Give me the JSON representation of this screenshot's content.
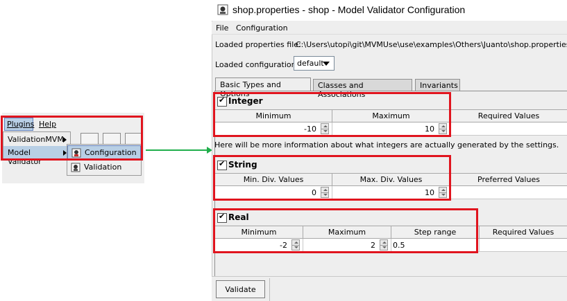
{
  "left_menu": {
    "menubar": {
      "plugins": "Plugins",
      "help": "Help"
    },
    "dropdown": [
      {
        "label": "ValidationMVM"
      },
      {
        "label": "Model Validator"
      }
    ],
    "submenu": [
      {
        "label": "Configuration",
        "icon": "model-validator-icon"
      },
      {
        "label": "Validation",
        "icon": "model-validator-icon"
      }
    ]
  },
  "window": {
    "title": "shop.properties - shop - Model Validator Configuration",
    "menu": {
      "file": "File",
      "configuration": "Configuration"
    },
    "loaded_file_label": "Loaded properties file:",
    "loaded_file_path": "C:\\Users\\utopi\\git\\MVMUse\\use\\examples\\Others\\Juanto\\shop.properties",
    "loaded_config_label": "Loaded configuration:",
    "loaded_config_value": "default",
    "tabs": [
      {
        "label": "Basic Types and Options",
        "active": true
      },
      {
        "label": "Classes and Associations",
        "active": false
      },
      {
        "label": "Invariants",
        "active": false
      }
    ],
    "integer": {
      "title": "Integer",
      "columns": [
        "Minimum",
        "Maximum",
        "Required Values"
      ],
      "min": "-10",
      "max": "10",
      "required": ""
    },
    "info_text": "Here will be more information about what integers are actually generated by the settings.",
    "string": {
      "title": "String",
      "columns": [
        "Min. Div. Values",
        "Max. Div. Values",
        "Preferred Values"
      ],
      "min": "0",
      "max": "10",
      "preferred": ""
    },
    "real": {
      "title": "Real",
      "columns": [
        "Minimum",
        "Maximum",
        "Step range",
        "Required Values"
      ],
      "min": "-2",
      "max": "2",
      "step": "0.5",
      "required": ""
    },
    "validate_button": "Validate"
  },
  "colors": {
    "highlight": "#e0141e",
    "arrow": "#1fae4b",
    "selection": "#b8cfe5"
  }
}
